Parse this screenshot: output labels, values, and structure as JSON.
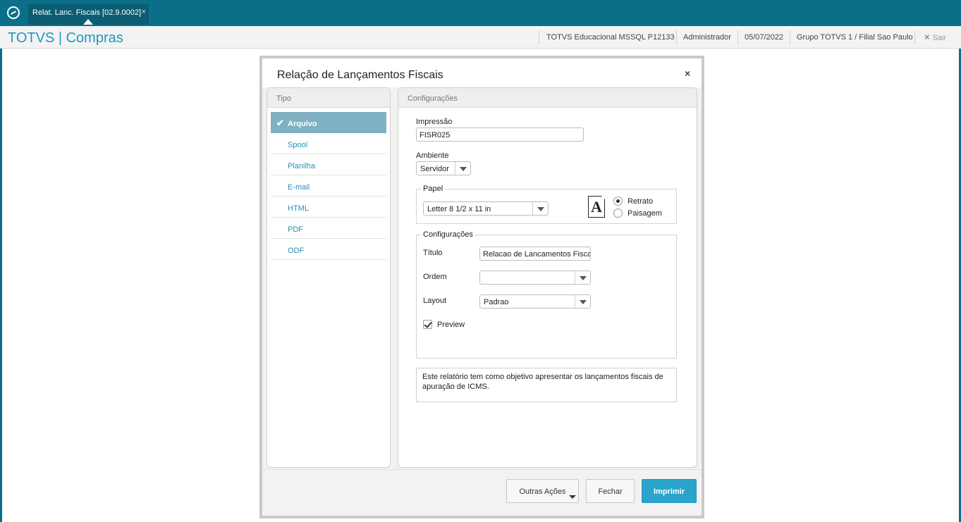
{
  "topbar": {
    "tab_label": "Relat. Lanc. Fiscais [02.9.0002]",
    "tab_close": "×"
  },
  "header": {
    "app_title": "TOTVS | Compras",
    "environment": "TOTVS Educacional MSSQL P12133",
    "user": "Administrador",
    "date": "05/07/2022",
    "branch": "Grupo TOTVS 1 / Filial Sao Paulo",
    "exit_label": "Sair",
    "exit_icon": "×"
  },
  "dialog": {
    "title": "Relação de Lançamentos Fiscais",
    "close": "×",
    "tipo": {
      "header": "Tipo",
      "items": [
        {
          "label": "Arquivo",
          "selected": true
        },
        {
          "label": "Spool"
        },
        {
          "label": "Planilha"
        },
        {
          "label": "E-mail"
        },
        {
          "label": "HTML"
        },
        {
          "label": "PDF"
        },
        {
          "label": "ODF"
        }
      ]
    },
    "config": {
      "header": "Configurações",
      "impressao_label": "Impressão",
      "impressao_value": "FISR025",
      "ambiente_label": "Ambiente",
      "ambiente_value": "Servidor",
      "papel": {
        "legend": "Papel",
        "size_value": "Letter 8 1/2 x 11 in",
        "icon_letter": "A",
        "retrato_label": "Retrato",
        "paisagem_label": "Paisagem",
        "orientation": "Retrato"
      },
      "configuracoes": {
        "legend": "Configurações",
        "titulo_label": "Título",
        "titulo_value": "Relacao de Lancamentos Fisca",
        "ordem_label": "Ordem",
        "ordem_value": "",
        "layout_label": "Layout",
        "layout_value": "Padrao",
        "preview_label": "Preview",
        "preview_checked": true
      },
      "description": "Este relatório tem como objetivo apresentar os lançamentos fiscais de apuração de ICMS."
    },
    "buttons": {
      "outras_acoes": "Outras Ações",
      "fechar": "Fechar",
      "imprimir": "Imprimir"
    }
  },
  "colors": {
    "topbar": "#0c6f89",
    "accent": "#2298bd",
    "selected_item": "#7fb1c2",
    "primary_button": "#2aa4cb"
  }
}
